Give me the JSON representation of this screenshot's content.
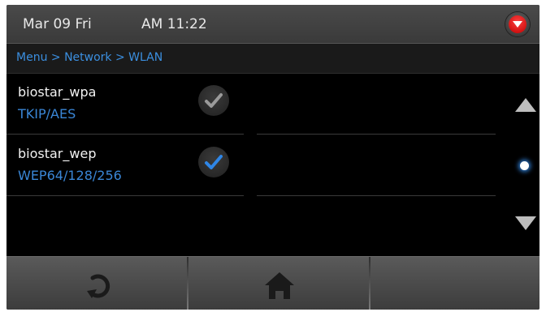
{
  "status_bar": {
    "date": "Mar 09 Fri",
    "time": "AM 11:22",
    "menu_icon": "red-dropdown-icon"
  },
  "breadcrumb": {
    "text": "Menu > Network > WLAN"
  },
  "networks": [
    {
      "ssid": "biostar_wpa",
      "security": "TKIP/AES",
      "selected": false
    },
    {
      "ssid": "biostar_wep",
      "security": "WEP64/128/256",
      "selected": true
    }
  ],
  "scroll": {
    "up_icon": "scroll-up-icon",
    "down_icon": "scroll-down-icon"
  },
  "bottom_bar": {
    "buttons": [
      "refresh-icon",
      "home-icon"
    ]
  },
  "colors": {
    "accent_blue": "#3a86d6",
    "status_red": "#e01010",
    "background": "#000000"
  }
}
